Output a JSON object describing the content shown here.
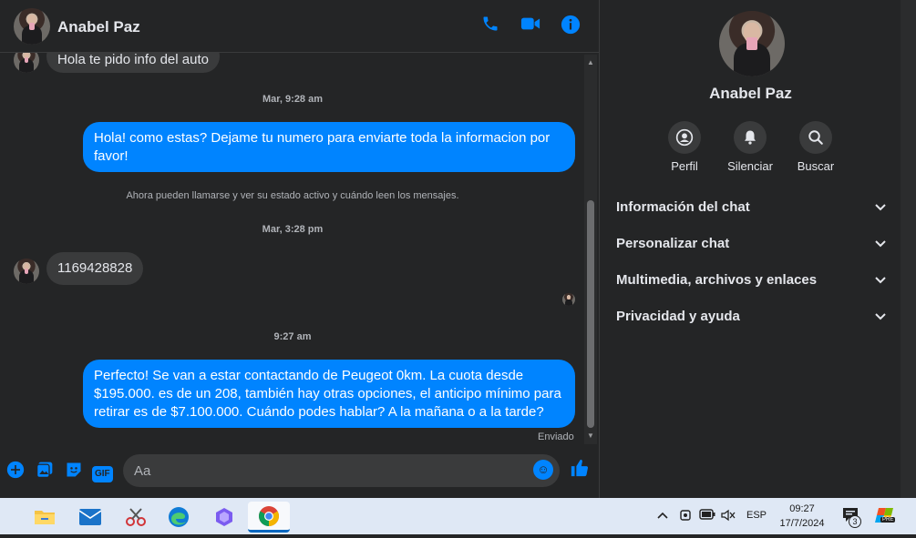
{
  "contact": {
    "name": "Anabel Paz"
  },
  "header": {
    "icons": [
      "phone-icon",
      "video-icon",
      "info-icon"
    ]
  },
  "messages": {
    "m1": "Hola te pido info del auto",
    "ts1": "Mar, 9:28 am",
    "m2": "Hola! como estas? Dejame tu numero para enviarte toda la informacion por favor!",
    "sys": "Ahora pueden llamarse y ver su estado activo y cuándo leen los mensajes.",
    "ts2": "Mar, 3:28 pm",
    "m3": "1169428828",
    "ts3": "9:27 am",
    "m4": "Perfecto!  Se van a estar contactando de Peugeot 0km. La cuota desde $195.000. es de un 208, también hay otras opciones, el anticipo mínimo para retirar es de $7.100.000. Cuándo podes hablar? A la mañana o a la tarde?",
    "status": "Enviado"
  },
  "composer": {
    "placeholder": "Aa",
    "gif_label": "GIF"
  },
  "sidebar": {
    "actions": [
      {
        "label": "Perfil",
        "icon": "profile-icon"
      },
      {
        "label": "Silenciar",
        "icon": "bell-icon"
      },
      {
        "label": "Buscar",
        "icon": "search-icon"
      }
    ],
    "sections": [
      "Información del chat",
      "Personalizar chat",
      "Multimedia, archivos y enlaces",
      "Privacidad y ayuda"
    ]
  },
  "taskbar": {
    "lang": "ESP",
    "time": "09:27",
    "date": "17/7/2024",
    "notifications": "3",
    "copilot_badge": "PRE"
  },
  "colors": {
    "accent": "#0084ff",
    "bg": "#242526",
    "bubble_in": "#3a3b3c"
  }
}
